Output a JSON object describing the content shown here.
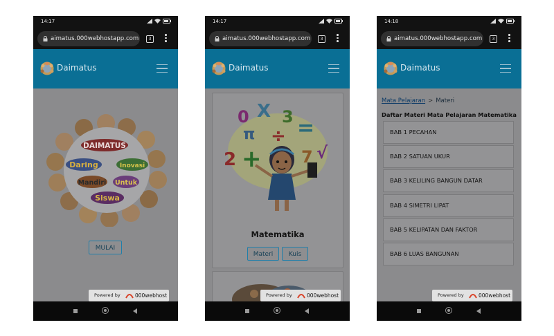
{
  "phone1": {
    "status": {
      "time": "14:17"
    },
    "browser": {
      "url": "aimatus.000webhostapp.com",
      "tabs_count": "3"
    },
    "app": {
      "brand": "Daimatus"
    },
    "hero": {
      "title": "DAIMATUS",
      "words": [
        "Daring",
        "Inovasi",
        "Mandiri",
        "Untuk",
        "Siswa"
      ]
    },
    "start_button": "MULAI",
    "powered": {
      "label": "Powered by",
      "name": "000webhost"
    }
  },
  "phone2": {
    "status": {
      "time": "14:17"
    },
    "browser": {
      "url": "aimatus.000webhostapp.com",
      "tabs_count": "3"
    },
    "app": {
      "brand": "Daimatus"
    },
    "card": {
      "title": "Matematika",
      "materi_button": "Materi",
      "kuis_button": "Kuis",
      "symbols": [
        "0",
        "X",
        "3",
        "π",
        "÷",
        "=",
        "2",
        "+",
        "7",
        "√"
      ]
    },
    "powered": {
      "label": "Powered by",
      "name": "000webhost"
    }
  },
  "phone3": {
    "status": {
      "time": "14:18"
    },
    "browser": {
      "url": "aimatus.000webhostapp.com",
      "tabs_count": "3"
    },
    "app": {
      "brand": "Daimatus"
    },
    "breadcrumb": {
      "link": "Mata Pelajaran",
      "separator": ">",
      "current": "Materi"
    },
    "heading": "Daftar Materi Mata Pelajaran Matematika",
    "items": [
      "BAB 1 PECAHAN",
      "BAB 2 SATUAN UKUR",
      "BAB 3 KELILING BANGUN DATAR",
      "BAB 4 SIMETRI LIPAT",
      "BAB 5 KELIPATAN DAN FAKTOR",
      "BAB 6 LUAS BANGUNAN"
    ],
    "powered": {
      "label": "Powered by",
      "name": "000webhost"
    }
  },
  "colors": {
    "appbar": "#0a6f95",
    "overlay_content": "#8b8b8d",
    "button_border": "#1f7faa"
  }
}
